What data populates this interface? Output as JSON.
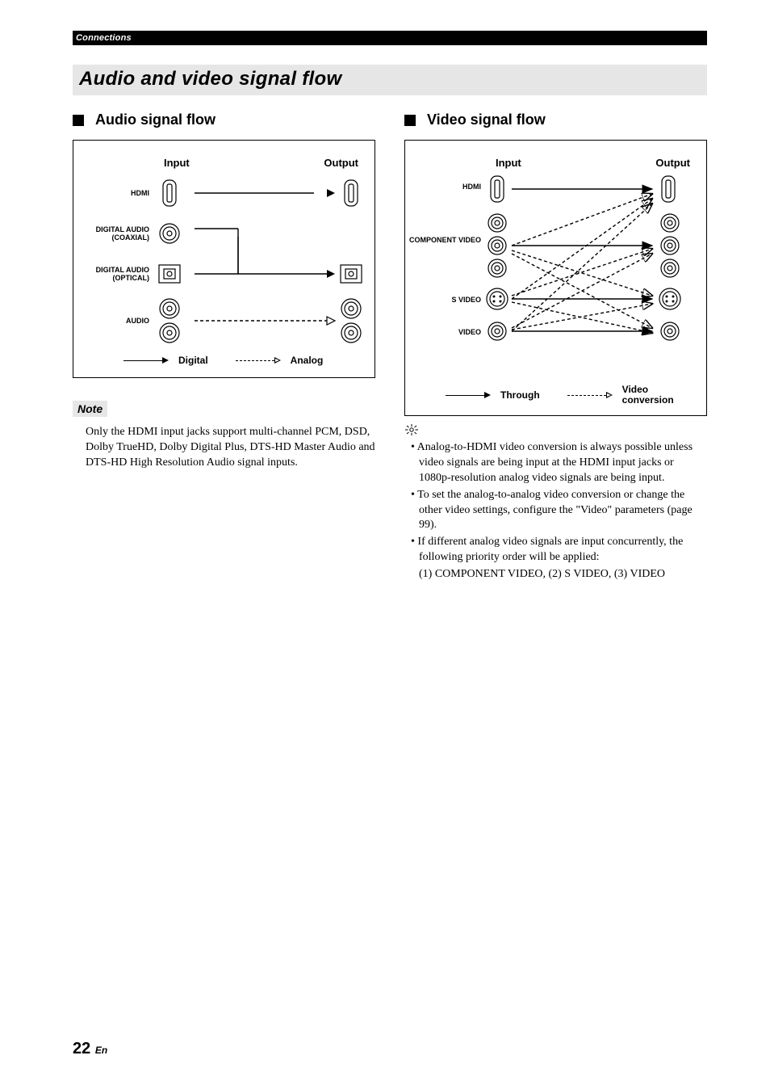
{
  "header": {
    "section_label": "Connections"
  },
  "title": "Audio and video signal flow",
  "audio": {
    "heading": "Audio signal flow",
    "input_label": "Input",
    "output_label": "Output",
    "rows": {
      "hdmi": "HDMI",
      "coax": "DIGITAL AUDIO (COAXIAL)",
      "optical": "DIGITAL AUDIO (OPTICAL)",
      "analog": "AUDIO"
    },
    "legend": {
      "digital": "Digital",
      "analog": "Analog"
    }
  },
  "video": {
    "heading": "Video signal flow",
    "input_label": "Input",
    "output_label": "Output",
    "rows": {
      "hdmi": "HDMI",
      "component": "COMPONENT VIDEO",
      "svideo": "S VIDEO",
      "cvbs": "VIDEO"
    },
    "legend": {
      "through": "Through",
      "conversion": "Video conversion"
    }
  },
  "note": {
    "label": "Note",
    "text": "Only the HDMI input jacks support multi-channel PCM, DSD, Dolby TrueHD, Dolby Digital Plus, DTS-HD Master Audio and DTS-HD High Resolution Audio signal inputs."
  },
  "hints": {
    "b1": "Analog-to-HDMI video conversion is always possible unless video signals are being input at the HDMI input jacks or 1080p-resolution analog video signals are being input.",
    "b2": "To set the analog-to-analog video conversion or change the other video settings, configure the \"Video\" parameters (page 99).",
    "b3": "If different analog video signals are input concurrently, the following priority order will be applied:",
    "b3_sub": "(1) COMPONENT VIDEO, (2) S VIDEO, (3) VIDEO"
  },
  "page_number": "22",
  "page_suffix": "En"
}
